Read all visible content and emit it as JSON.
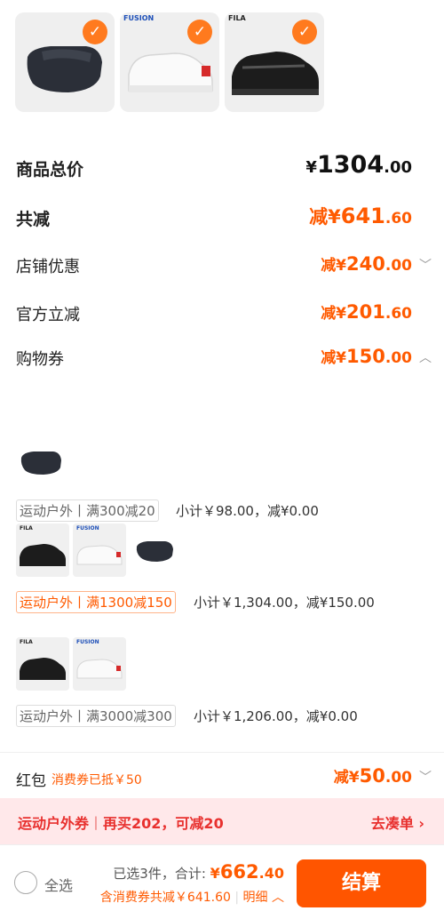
{
  "products": [
    {
      "name": "visor",
      "checked": true
    },
    {
      "name": "white-sneaker",
      "brand": "FUSION",
      "checked": true
    },
    {
      "name": "black-sneaker",
      "brand": "FILA",
      "checked": true
    }
  ],
  "summary": {
    "total_label": "商品总价",
    "total_currency": "¥",
    "total_int": "1304",
    "total_dec": ".00",
    "discount_label": "共减",
    "discount_prefix": "减¥",
    "discount_int": "641",
    "discount_dec": ".60",
    "store_label": "店铺优惠",
    "store_prefix": "减¥",
    "store_int": "240",
    "store_dec": ".00",
    "official_label": "官方立减",
    "official_prefix": "减¥",
    "official_int": "201",
    "official_dec": ".60",
    "coupon_label": "购物券",
    "coupon_prefix": "减¥",
    "coupon_int": "150",
    "coupon_dec": ".00"
  },
  "groups": [
    {
      "promo": "运动户外丨满300减20",
      "subtotal": "小计￥98.00，减¥0.00"
    },
    {
      "promo": "运动户外丨满1300减150",
      "subtotal": "小计￥1,304.00，减¥150.00"
    },
    {
      "promo": "运动户外丨满3000减300",
      "subtotal": "小计￥1,206.00，减¥0.00"
    }
  ],
  "red_packet": {
    "label": "红包",
    "note": "消费券已抵￥50",
    "prefix": "减¥",
    "int": "50",
    "dec": ".00"
  },
  "banner": {
    "category": "运动户外券",
    "sep": "丨",
    "text": "再买202，可减20",
    "link": "去凑单"
  },
  "bottom_bar": {
    "select_all": "全选",
    "selected": "已选3件，合计:",
    "total_prefix": "¥",
    "total_int": "662",
    "total_dec": ".40",
    "saving": "含消费券共减￥641.60",
    "detail": "明细",
    "checkout": "结算"
  },
  "colors": {
    "accent": "#ff5500",
    "discount": "#ff5a00",
    "banner_bg": "#ffe8ea",
    "banner_text": "#e8302e"
  }
}
